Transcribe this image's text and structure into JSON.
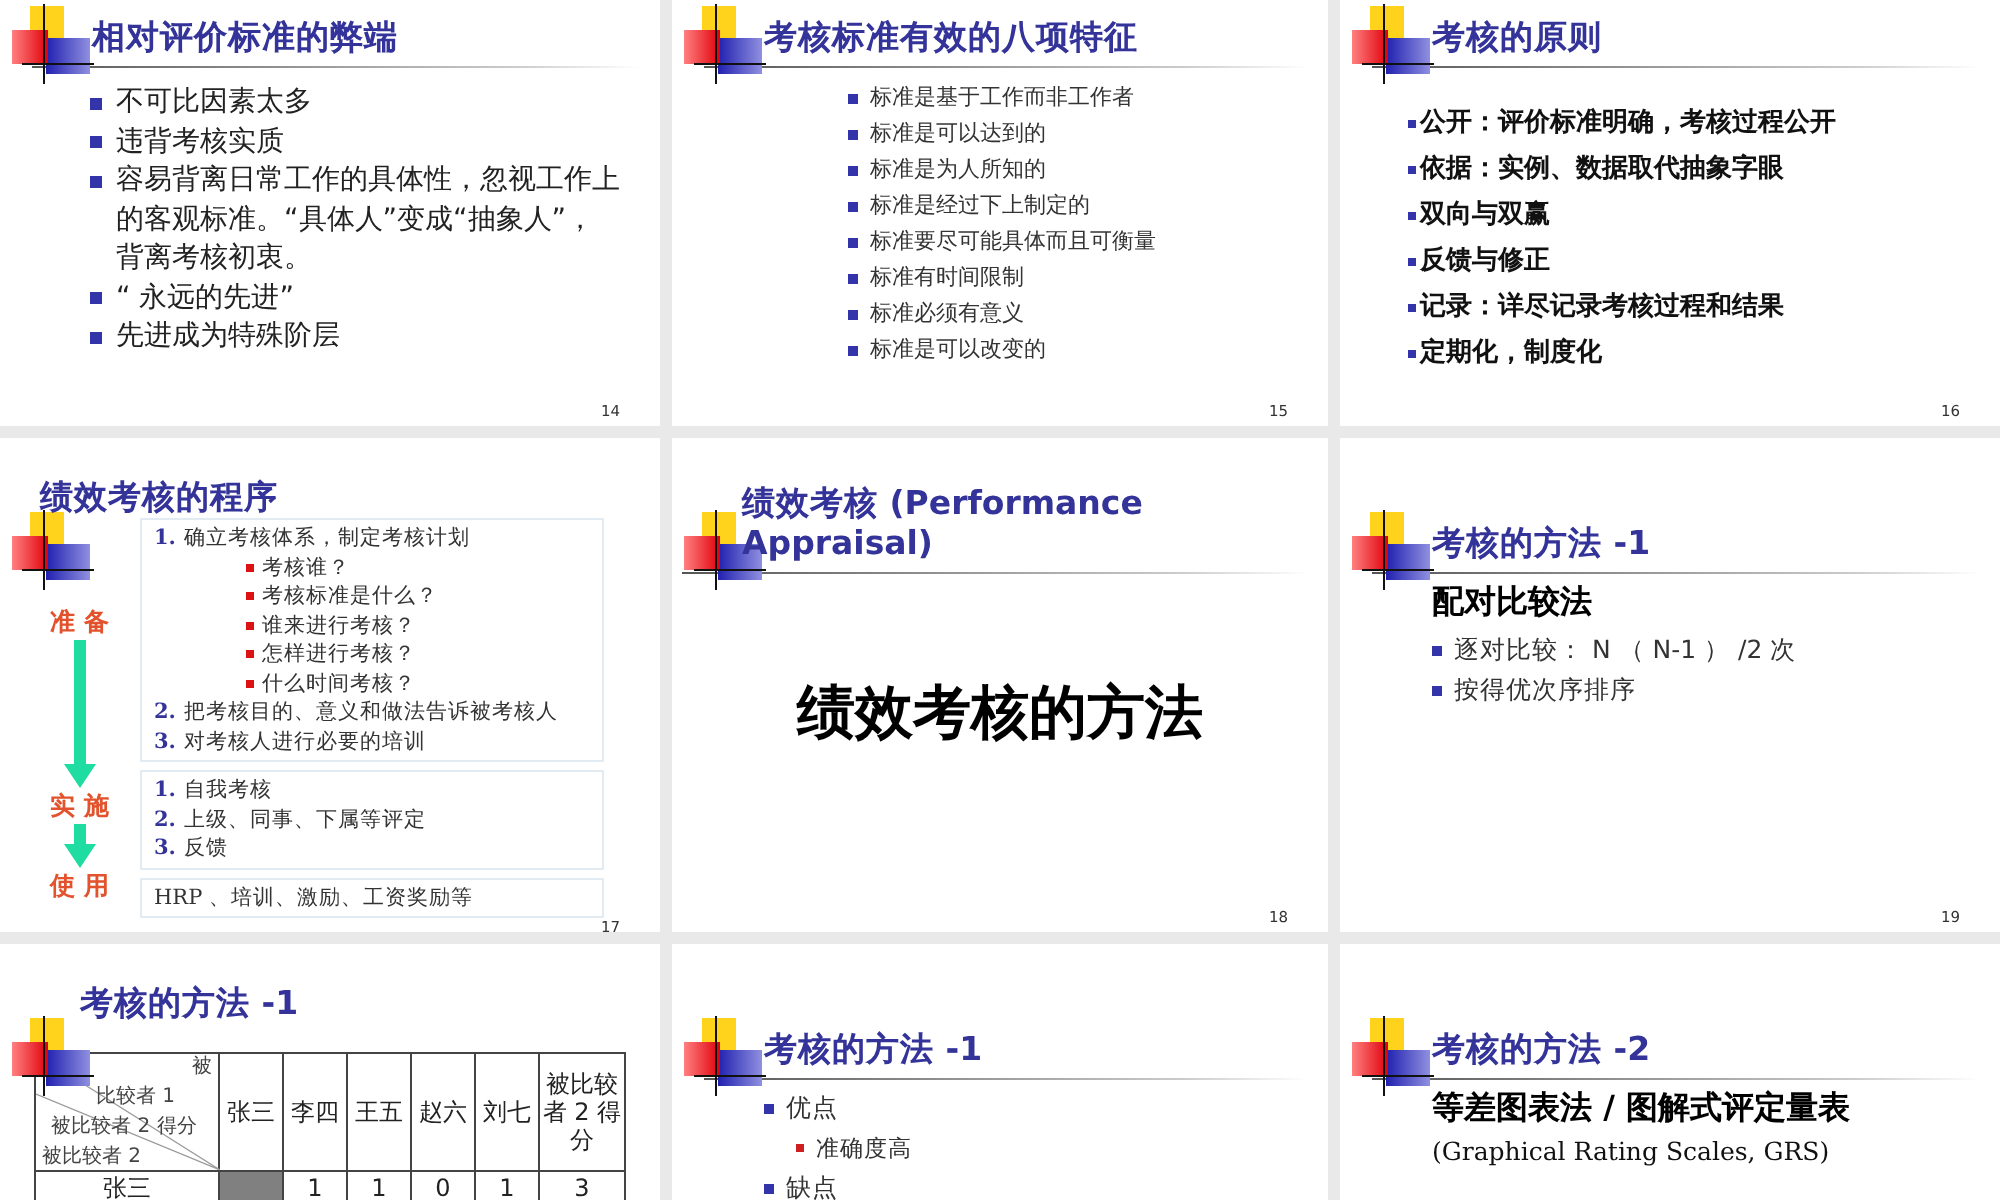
{
  "slides": [
    {
      "number": "14",
      "kind": "bullets",
      "title": "相对评价标准的弊端",
      "bullets": [
        {
          "text": "不可比因素太多"
        },
        {
          "text": "违背考核实质"
        },
        {
          "text": "容易背离日常工作的具体性，忽视工作上的客观标准。“具体人”变成“抽象人”，背离考核初衷。"
        },
        {
          "text": "“ 永远的先进”"
        },
        {
          "text": "先进成为特殊阶层"
        }
      ]
    },
    {
      "number": "15",
      "kind": "list",
      "title": "考核标准有效的八项特征",
      "bullets": [
        {
          "text": "标准是基于工作而非工作者"
        },
        {
          "text": "标准是可以达到的"
        },
        {
          "text": "标准是为人所知的"
        },
        {
          "text": "标准是经过下上制定的"
        },
        {
          "text": "标准要尽可能具体而且可衡量"
        },
        {
          "text": "标准有时间限制"
        },
        {
          "text": "标准必须有意义"
        },
        {
          "text": "标准是可以改变的"
        }
      ]
    },
    {
      "number": "16",
      "kind": "points",
      "title": "考核的原则",
      "bullets": [
        {
          "text": "公开：评价标准明确，考核过程公开"
        },
        {
          "text": "依据：实例、数据取代抽象字眼"
        },
        {
          "text": "双向与双赢"
        },
        {
          "text": "反馈与修正"
        },
        {
          "text": "记录：详尽记录考核过程和结果"
        },
        {
          "text": "定期化，制度化"
        }
      ]
    },
    {
      "number": "17",
      "kind": "procedure",
      "title": "绩效考核的程序",
      "stages": [
        "准 备",
        "实 施",
        "使 用"
      ],
      "boxes": [
        {
          "items": [
            {
              "number": "1.",
              "text": "确立考核体系，制定考核计划",
              "children": [
                {
                  "text": "考核谁？"
                },
                {
                  "text": "考核标准是什么？"
                },
                {
                  "text": "谁来进行考核？"
                },
                {
                  "text": "怎样进行考核？"
                },
                {
                  "text": "什么时间考核？"
                }
              ]
            },
            {
              "number": "2.",
              "text": "把考核目的、意义和做法告诉被考核人"
            },
            {
              "number": "3.",
              "text": "对考核人进行必要的培训"
            }
          ]
        },
        {
          "items": [
            {
              "number": "1.",
              "text": "自我考核"
            },
            {
              "number": "2.",
              "text": "上级、同事、下属等评定"
            },
            {
              "number": "3.",
              "text": "反馈"
            }
          ]
        },
        {
          "items": [
            {
              "text": "HRP 、培训、激励、工资奖励等"
            }
          ]
        }
      ]
    },
    {
      "number": "18",
      "kind": "section",
      "title": "绩效考核 (Performance Appraisal)",
      "big_text": "绩效考核的方法"
    },
    {
      "number": "19",
      "kind": "method",
      "title": "考核的方法 -1",
      "heading": "配对比较法",
      "bullets": [
        {
          "text": "逐对比较： N （ N-1 ） /2 次"
        },
        {
          "text": "按得优次序排序"
        }
      ]
    },
    {
      "kind": "table",
      "title": "考核的方法 -1",
      "table": {
        "corner": [
          "被",
          "比较者 1",
          "被比较者 2 得分",
          "被比较者 2"
        ],
        "columns": [
          "张三",
          "李四",
          "王五",
          "赵六",
          "刘七",
          "被比较者 2 得分"
        ],
        "rows": [
          {
            "label": "张三",
            "cells": [
              {
                "shaded": true
              },
              {
                "text": "1"
              },
              {
                "text": "1"
              },
              {
                "text": "0"
              },
              {
                "text": "1"
              },
              {
                "text": "3"
              }
            ]
          }
        ]
      }
    },
    {
      "kind": "method",
      "title": "考核的方法 -1",
      "bullets": [
        {
          "text": "优点",
          "children": [
            {
              "text": "准确度高"
            }
          ]
        },
        {
          "text": "缺点"
        }
      ]
    },
    {
      "kind": "method",
      "title": "考核的方法 -2",
      "heading": "等差图表法 / 图解式评定量表",
      "subheading": "(Graphical Rating Scales, GRS)"
    }
  ]
}
